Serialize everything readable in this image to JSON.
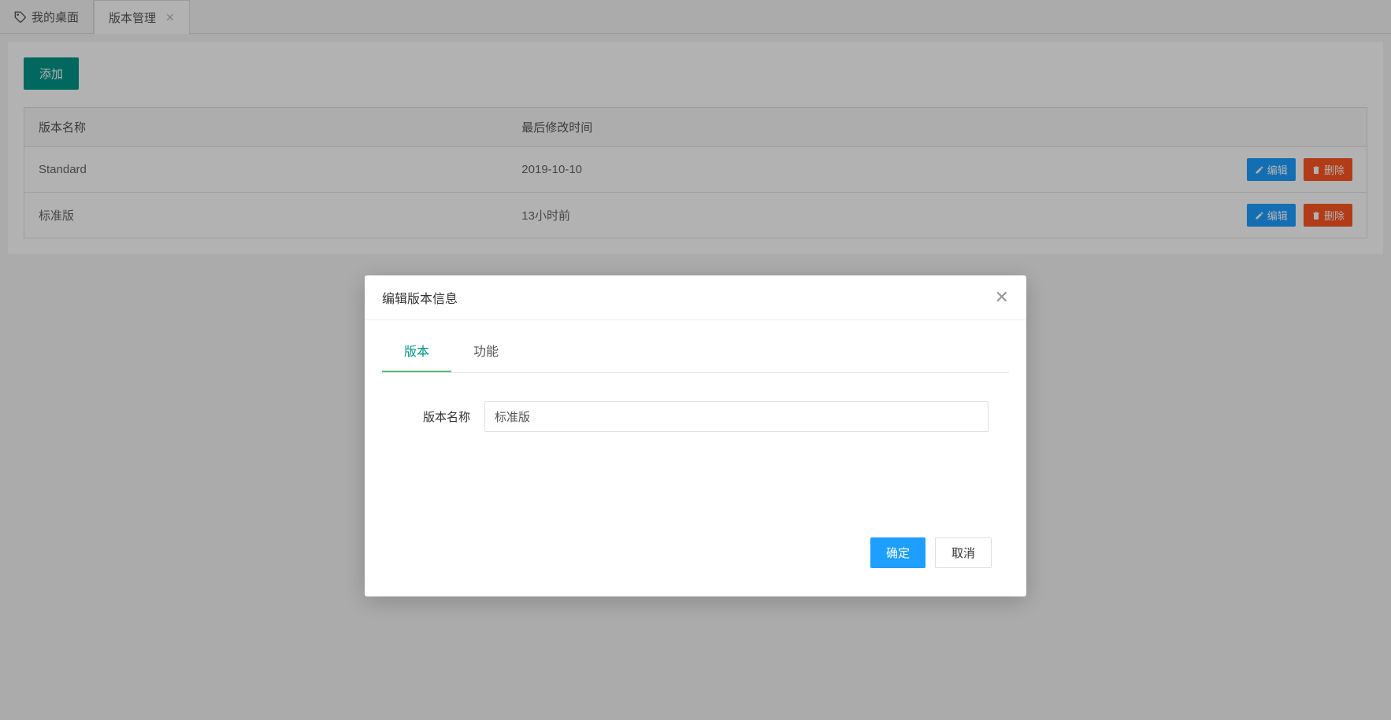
{
  "tabs": {
    "desktop": "我的桌面",
    "current": "版本管理"
  },
  "toolbar": {
    "add_label": "添加"
  },
  "table": {
    "headers": {
      "name": "版本名称",
      "modified": "最后修改时间",
      "actions": ""
    },
    "rows": [
      {
        "name": "Standard",
        "modified": "2019-10-10"
      },
      {
        "name": "标准版",
        "modified": "13小时前"
      }
    ],
    "actions": {
      "edit": "编辑",
      "delete": "删除"
    }
  },
  "modal": {
    "title": "编辑版本信息",
    "tabs": {
      "version": "版本",
      "feature": "功能"
    },
    "form": {
      "name_label": "版本名称",
      "name_value": "标准版"
    },
    "buttons": {
      "confirm": "确定",
      "cancel": "取消"
    }
  }
}
